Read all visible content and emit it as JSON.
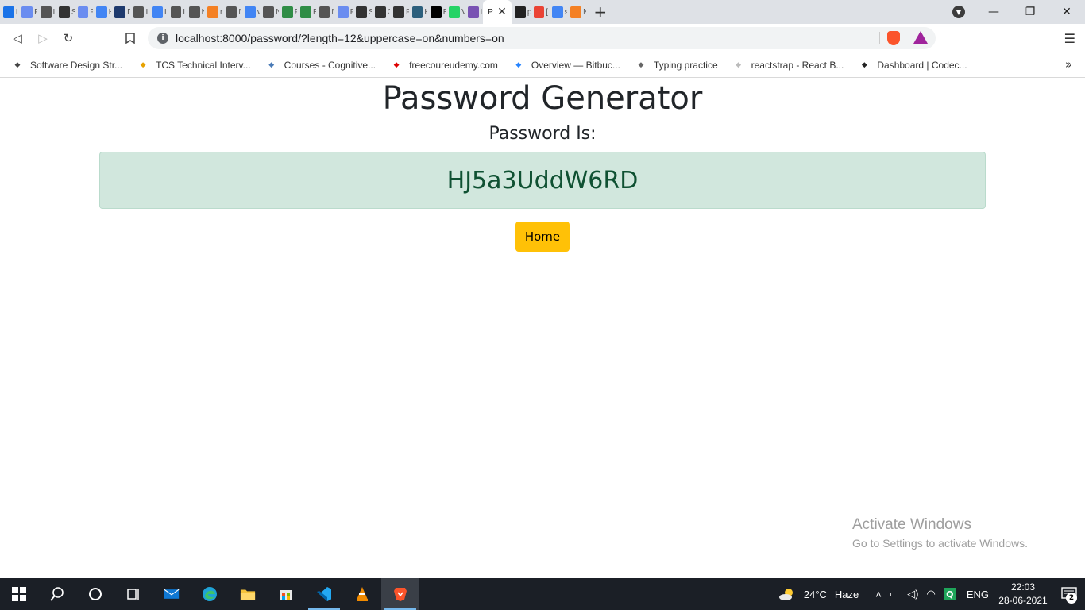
{
  "browser": {
    "tabs": [
      {
        "icon": "is-icon",
        "label": "I",
        "color": "#1a73e8"
      },
      {
        "icon": "gem-icon",
        "label": "F",
        "color": "#6b8df0"
      },
      {
        "icon": "globe-icon",
        "label": "I",
        "color": "#555555"
      },
      {
        "icon": "wikipedia-icon",
        "label": "S",
        "color": "#333333"
      },
      {
        "icon": "gem-icon",
        "label": "F",
        "color": "#6b8df0"
      },
      {
        "icon": "google-icon",
        "label": "H",
        "color": "#4285f4"
      },
      {
        "icon": "shield-icon",
        "label": "D",
        "color": "#1e3a6e"
      },
      {
        "icon": "globe-icon",
        "label": "I",
        "color": "#555555"
      },
      {
        "icon": "google-icon",
        "label": "I",
        "color": "#4285f4"
      },
      {
        "icon": "globe-icon",
        "label": "I",
        "color": "#555555"
      },
      {
        "icon": "globe-icon",
        "label": "N",
        "color": "#555555"
      },
      {
        "icon": "stackoverflow-icon",
        "label": "r",
        "color": "#f48024"
      },
      {
        "icon": "globe-icon",
        "label": "N",
        "color": "#555555"
      },
      {
        "icon": "google-icon",
        "label": "v",
        "color": "#4285f4"
      },
      {
        "icon": "globe-icon",
        "label": "N",
        "color": "#555555"
      },
      {
        "icon": "geeksforgeeks-icon",
        "label": "F",
        "color": "#2f8d46"
      },
      {
        "icon": "geeksforgeeks-icon",
        "label": "E",
        "color": "#2f8d46"
      },
      {
        "icon": "globe-icon",
        "label": "N",
        "color": "#555555"
      },
      {
        "icon": "gem-icon",
        "label": "F",
        "color": "#6b8df0"
      },
      {
        "icon": "wikipedia-icon",
        "label": "S",
        "color": "#333333"
      },
      {
        "icon": "wikipedia-icon",
        "label": "C",
        "color": "#333333"
      },
      {
        "icon": "wikipedia-icon",
        "label": "F",
        "color": "#333333"
      },
      {
        "icon": "hackerrank-icon",
        "label": "H",
        "color": "#2c5f7c"
      },
      {
        "icon": "dev-icon",
        "label": "E",
        "color": "#000000"
      },
      {
        "icon": "whatsapp-icon",
        "label": "V",
        "color": "#25d366"
      },
      {
        "icon": "bootstrap-icon",
        "label": "I",
        "color": "#7952b3"
      }
    ],
    "active_tab": {
      "label": "P",
      "close": "✕"
    },
    "tabs_after": [
      {
        "icon": "github-icon",
        "label": "p",
        "color": "#222222"
      },
      {
        "icon": "gmail-icon",
        "label": "[",
        "color": "#ea4335"
      },
      {
        "icon": "google-icon",
        "label": "s",
        "color": "#4285f4"
      },
      {
        "icon": "stackoverflow-icon",
        "label": "N",
        "color": "#f48024"
      }
    ],
    "new_tab": "+",
    "url": "localhost:8000/password/?length=12&uppercase=on&numbers=on",
    "bookmarks": [
      {
        "icon": "diamond-icon",
        "label": "Software Design Str..."
      },
      {
        "icon": "tcs-icon",
        "label": "TCS Technical Interv..."
      },
      {
        "icon": "cognitive-icon",
        "label": "Courses - Cognitive..."
      },
      {
        "icon": "free-icon",
        "label": "freecoureudemy.com"
      },
      {
        "icon": "bitbucket-icon",
        "label": "Overview — Bitbuc..."
      },
      {
        "icon": "typing-icon",
        "label": "Typing practice"
      },
      {
        "icon": "react-icon",
        "label": "reactstrap - React B..."
      },
      {
        "icon": "codecademy-icon",
        "label": "Dashboard | Codec..."
      }
    ],
    "bookmarks_more": "»"
  },
  "page": {
    "title": "Password Generator",
    "subtitle": "Password Is:",
    "password": "HJ5a3UddW6RD",
    "home_button": "Home"
  },
  "watermark": {
    "line1": "Activate Windows",
    "line2": "Go to Settings to activate Windows."
  },
  "taskbar": {
    "weather": "24°C",
    "weather_desc": "Haze",
    "language": "ENG",
    "time": "22:03",
    "date": "28-06-2021",
    "notification_count": "2"
  }
}
